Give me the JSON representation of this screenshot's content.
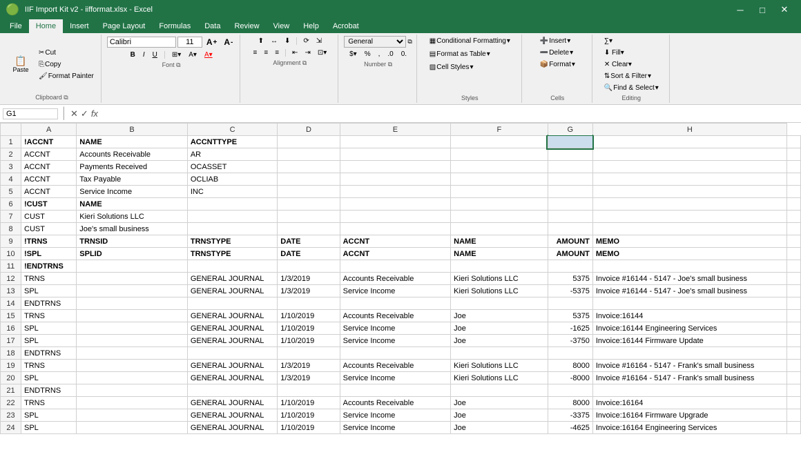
{
  "titleBar": {
    "text": "IIF Import Kit v2 - iifformat.xlsx - Excel",
    "minimize": "─",
    "maximize": "□",
    "close": "✕"
  },
  "tabs": [
    "File",
    "Home",
    "Insert",
    "Page Layout",
    "Formulas",
    "Data",
    "Review",
    "View",
    "Help",
    "Acrobat"
  ],
  "activeTab": "Home",
  "ribbon": {
    "clipboard": {
      "label": "Clipboard",
      "paste": "Paste",
      "cut": "✂",
      "copy": "⎘",
      "format_painter": "🖌"
    },
    "font": {
      "label": "Font",
      "name": "Calibri",
      "size": "11",
      "grow": "A↑",
      "shrink": "A↓",
      "bold": "B",
      "italic": "I",
      "underline": "U",
      "border": "⊞",
      "fill": "A",
      "color": "A"
    },
    "alignment": {
      "label": "Alignment",
      "format_minus": "Formatting -",
      "format_plus": "Format +"
    },
    "number": {
      "label": "Number",
      "general": "General",
      "percent": "%",
      "comma": ",",
      "increase_dec": ".0→",
      "decrease_dec": "←.0"
    },
    "styles": {
      "label": "Styles",
      "conditional": "Conditional Formatting",
      "format_table": "Format as Table",
      "cell_styles": "Cell Styles"
    },
    "cells": {
      "label": "Cells",
      "insert": "Insert",
      "delete": "Delete",
      "format": "Format"
    },
    "editing": {
      "label": "Editing",
      "sort_filter": "Sort & Filter",
      "find_select": "Find & Select"
    }
  },
  "formulaBar": {
    "cellRef": "G1",
    "cancelIcon": "✕",
    "confirmIcon": "✓",
    "functionIcon": "fx",
    "formula": ""
  },
  "columns": [
    "",
    "A",
    "B",
    "C",
    "D",
    "E",
    "F",
    "G",
    "H"
  ],
  "rows": [
    {
      "id": 1,
      "cells": [
        "!ACCNT",
        "NAME",
        "ACCNTTYPE",
        "",
        "",
        "",
        "",
        "",
        ""
      ]
    },
    {
      "id": 2,
      "cells": [
        "ACCNT",
        "Accounts Receivable",
        "AR",
        "",
        "",
        "",
        "",
        "",
        ""
      ]
    },
    {
      "id": 3,
      "cells": [
        "ACCNT",
        "Payments Received",
        "OCASSET",
        "",
        "",
        "",
        "",
        "",
        ""
      ]
    },
    {
      "id": 4,
      "cells": [
        "ACCNT",
        "Tax Payable",
        "OCLIAB",
        "",
        "",
        "",
        "",
        "",
        ""
      ]
    },
    {
      "id": 5,
      "cells": [
        "ACCNT",
        "Service Income",
        "INC",
        "",
        "",
        "",
        "",
        "",
        ""
      ]
    },
    {
      "id": 6,
      "cells": [
        "!CUST",
        "NAME",
        "",
        "",
        "",
        "",
        "",
        "",
        ""
      ]
    },
    {
      "id": 7,
      "cells": [
        "CUST",
        "Kieri Solutions LLC",
        "",
        "",
        "",
        "",
        "",
        "",
        ""
      ]
    },
    {
      "id": 8,
      "cells": [
        "CUST",
        "Joe's small business",
        "",
        "",
        "",
        "",
        "",
        "",
        ""
      ]
    },
    {
      "id": 9,
      "cells": [
        "!TRNS",
        "TRNSID",
        "TRNSTYPE",
        "DATE",
        "ACCNT",
        "NAME",
        "AMOUNT",
        "MEMO",
        ""
      ]
    },
    {
      "id": 10,
      "cells": [
        "!SPL",
        "SPLID",
        "TRNSTYPE",
        "DATE",
        "ACCNT",
        "NAME",
        "AMOUNT",
        "MEMO",
        ""
      ]
    },
    {
      "id": 11,
      "cells": [
        "!ENDTRNS",
        "",
        "",
        "",
        "",
        "",
        "",
        "",
        ""
      ]
    },
    {
      "id": 12,
      "cells": [
        "TRNS",
        "",
        "GENERAL JOURNAL",
        "1/3/2019",
        "Accounts Receivable",
        "Kieri Solutions LLC",
        "5375",
        "Invoice #16144 - 5147 - Joe's small business",
        ""
      ]
    },
    {
      "id": 13,
      "cells": [
        "SPL",
        "",
        "GENERAL JOURNAL",
        "1/3/2019",
        "Service Income",
        "Kieri Solutions LLC",
        "-5375",
        "Invoice #16144 - 5147 - Joe's small business",
        ""
      ]
    },
    {
      "id": 14,
      "cells": [
        "ENDTRNS",
        "",
        "",
        "",
        "",
        "",
        "",
        "",
        ""
      ]
    },
    {
      "id": 15,
      "cells": [
        "TRNS",
        "",
        "GENERAL JOURNAL",
        "1/10/2019",
        "Accounts Receivable",
        "Joe",
        "5375",
        "Invoice:16144",
        ""
      ]
    },
    {
      "id": 16,
      "cells": [
        "SPL",
        "",
        "GENERAL JOURNAL",
        "1/10/2019",
        "Service Income",
        "Joe",
        "-1625",
        "Invoice:16144  Engineering Services",
        ""
      ]
    },
    {
      "id": 17,
      "cells": [
        "SPL",
        "",
        "GENERAL JOURNAL",
        "1/10/2019",
        "Service Income",
        "Joe",
        "-3750",
        "Invoice:16144  Firmware Update",
        ""
      ]
    },
    {
      "id": 18,
      "cells": [
        "ENDTRNS",
        "",
        "",
        "",
        "",
        "",
        "",
        "",
        ""
      ]
    },
    {
      "id": 19,
      "cells": [
        "TRNS",
        "",
        "GENERAL JOURNAL",
        "1/3/2019",
        "Accounts Receivable",
        "Kieri Solutions LLC",
        "8000",
        "Invoice #16164 - 5147 - Frank's small business",
        ""
      ]
    },
    {
      "id": 20,
      "cells": [
        "SPL",
        "",
        "GENERAL JOURNAL",
        "1/3/2019",
        "Service Income",
        "Kieri Solutions LLC",
        "-8000",
        "Invoice #16164 - 5147 - Frank's small business",
        ""
      ]
    },
    {
      "id": 21,
      "cells": [
        "ENDTRNS",
        "",
        "",
        "",
        "",
        "",
        "",
        "",
        ""
      ]
    },
    {
      "id": 22,
      "cells": [
        "TRNS",
        "",
        "GENERAL JOURNAL",
        "1/10/2019",
        "Accounts Receivable",
        "Joe",
        "8000",
        "Invoice:16164",
        ""
      ]
    },
    {
      "id": 23,
      "cells": [
        "SPL",
        "",
        "GENERAL JOURNAL",
        "1/10/2019",
        "Service Income",
        "Joe",
        "-3375",
        "Invoice:16164  Firmware Upgrade",
        ""
      ]
    },
    {
      "id": 24,
      "cells": [
        "SPL",
        "",
        "GENERAL JOURNAL",
        "1/10/2019",
        "Service Income",
        "Joe",
        "-4625",
        "Invoice:16164  Engineering Services",
        ""
      ]
    }
  ],
  "selectedCell": "G1"
}
